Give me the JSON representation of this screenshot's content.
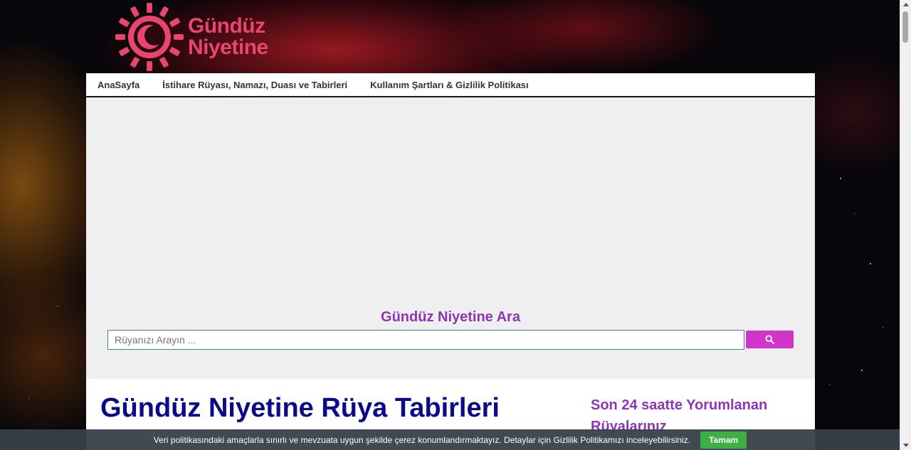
{
  "logo": {
    "line1": "Gündüz",
    "line2": "Niyetine"
  },
  "nav": {
    "items": [
      "AnaSayfa",
      "İstihare Rüyası, Namazı, Duası ve Tabirleri",
      "Kullanım Şartları & Gizlilik Politikası"
    ]
  },
  "search": {
    "title": "Gündüz Niyetine Ara",
    "placeholder": "Rüyanızı Arayın ..."
  },
  "main": {
    "title": "Gündüz Niyetine Rüya Tabirleri"
  },
  "sidebar": {
    "title": "Son 24 saatte Yorumlanan Rüyalarınız"
  },
  "cookie": {
    "text": "Veri politikasındaki amaçlarla sınırlı ve mevzuata uygun şekilde çerez konumlandırmaktayız. Detaylar için Gizlilik Politikamızı inceleyebilirsiniz.",
    "button": "Tamam"
  },
  "colors": {
    "accent": "#8e35b4",
    "brand": "#e8466f",
    "search_button": "#d134c9",
    "title": "#0b0b8a",
    "cookie_button": "#3cb043"
  },
  "icons": {
    "search_button": "search-icon",
    "logo_mark": "sun-crescent-icon"
  }
}
